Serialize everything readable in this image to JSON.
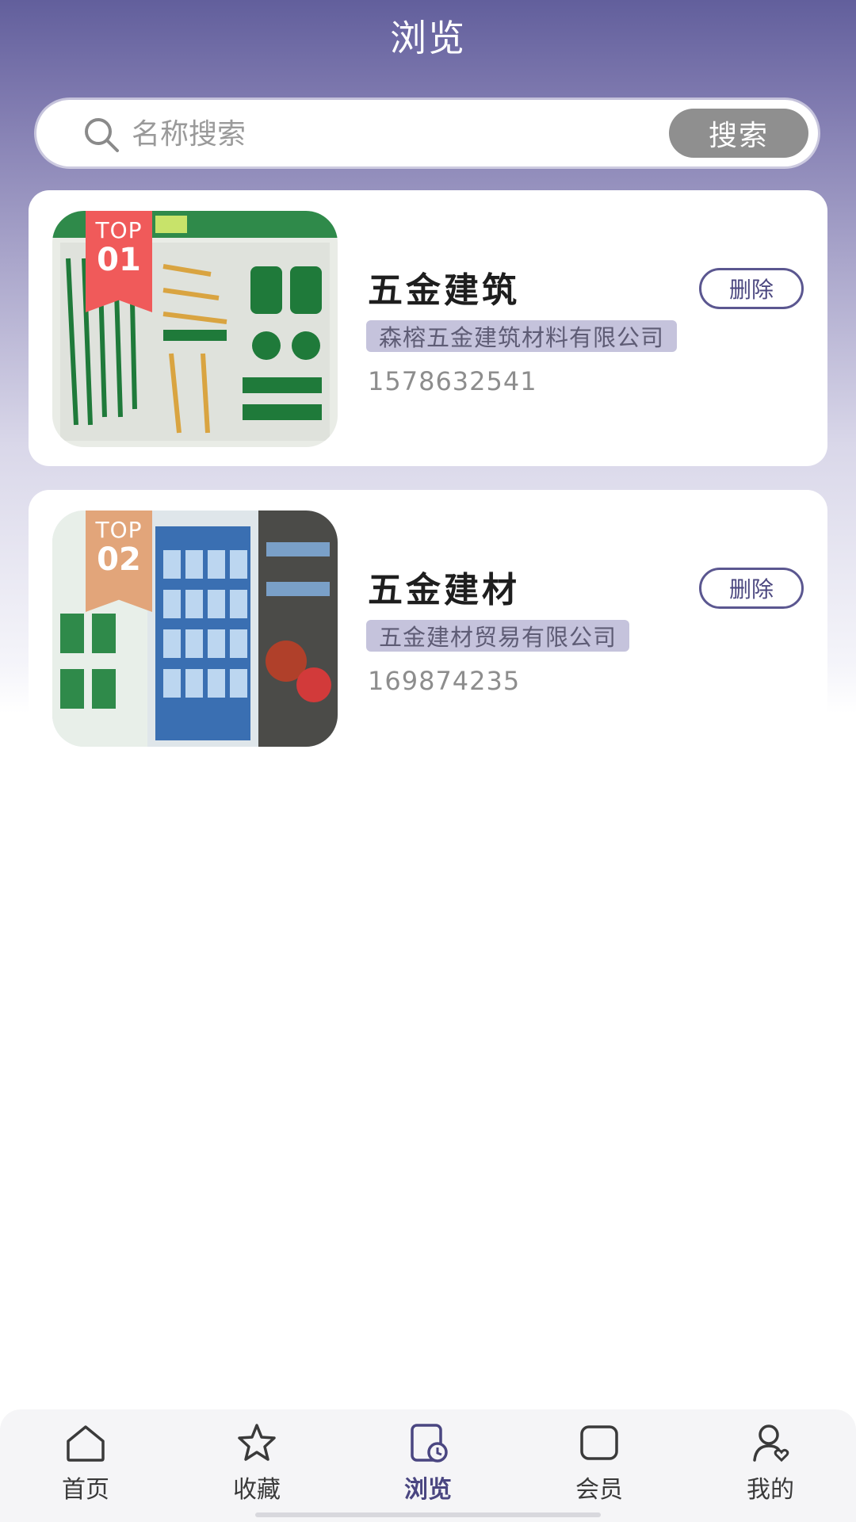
{
  "header": {
    "title": "浏览"
  },
  "search": {
    "placeholder": "名称搜索",
    "value": "",
    "button_label": "搜索",
    "icon": "search-icon"
  },
  "items": [
    {
      "badge_top": "TOP",
      "badge_num": "01",
      "badge_color": "#f05a5a",
      "title": "五金建筑",
      "delete_label": "删除",
      "company": "森榕五金建筑材料有限公司",
      "phone": "1578632541"
    },
    {
      "badge_top": "TOP",
      "badge_num": "02",
      "badge_color": "#e2a57a",
      "title": "五金建材",
      "delete_label": "删除",
      "company": "五金建材贸易有限公司",
      "phone": "169874235"
    }
  ],
  "nav": {
    "items": [
      {
        "label": "首页",
        "icon": "home-icon",
        "active": false
      },
      {
        "label": "收藏",
        "icon": "star-icon",
        "active": false
      },
      {
        "label": "浏览",
        "icon": "browse-history-icon",
        "active": true
      },
      {
        "label": "会员",
        "icon": "member-icon",
        "active": false
      },
      {
        "label": "我的",
        "icon": "profile-icon",
        "active": false
      }
    ]
  },
  "colors": {
    "accent": "#4a4681",
    "header_gradient_top": "#625f9c",
    "tag_bg": "#c5c3dc"
  }
}
